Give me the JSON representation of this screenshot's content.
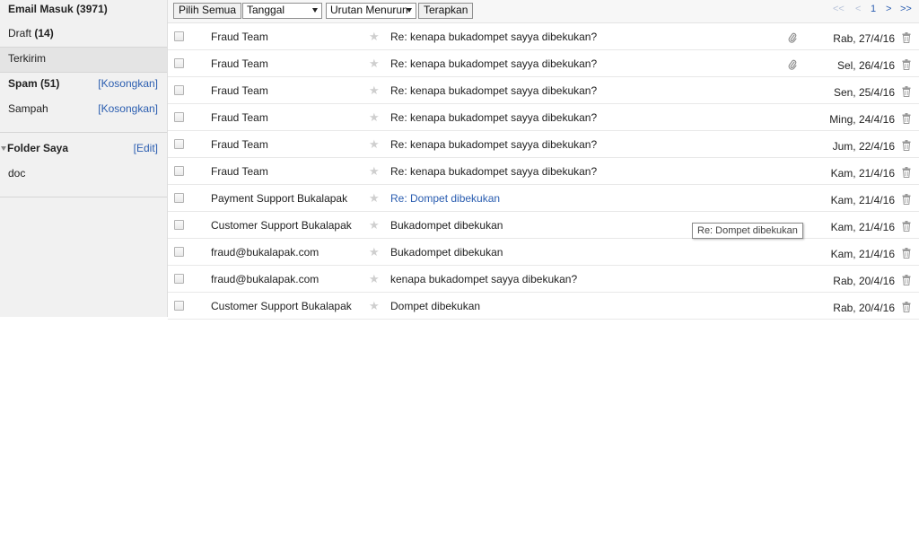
{
  "sidebar": {
    "inbox": {
      "label": "Email Masuk",
      "count": "(3971)"
    },
    "draft": {
      "label": "Draft",
      "count": "(14)"
    },
    "sent": {
      "label": "Terkirim"
    },
    "spam": {
      "label": "Spam",
      "count": "(51)",
      "action": "[Kosongkan]"
    },
    "trash": {
      "label": "Sampah",
      "action": "[Kosongkan]"
    },
    "folders": {
      "label": "Folder Saya",
      "action": "[Edit]",
      "items": [
        "doc"
      ]
    }
  },
  "toolbar": {
    "select_all": "Pilih Semua",
    "sort_field": "Tanggal",
    "sort_order": "Urutan Menurun",
    "apply": "Terapkan",
    "pager": {
      "first": "<<",
      "prev": "<",
      "current": "1",
      "next": ">",
      "last": ">>"
    }
  },
  "emails": [
    {
      "sender": "Fraud Team",
      "subject": "Re: kenapa bukadompet sayya dibekukan?",
      "date": "Rab, 27/4/16",
      "attachment": true,
      "link": false
    },
    {
      "sender": "Fraud Team",
      "subject": "Re: kenapa bukadompet sayya dibekukan?",
      "date": "Sel, 26/4/16",
      "attachment": true,
      "link": false
    },
    {
      "sender": "Fraud Team",
      "subject": "Re: kenapa bukadompet sayya dibekukan?",
      "date": "Sen, 25/4/16",
      "attachment": false,
      "link": false
    },
    {
      "sender": "Fraud Team",
      "subject": "Re: kenapa bukadompet sayya dibekukan?",
      "date": "Ming, 24/4/16",
      "attachment": false,
      "link": false
    },
    {
      "sender": "Fraud Team",
      "subject": "Re: kenapa bukadompet sayya dibekukan?",
      "date": "Jum, 22/4/16",
      "attachment": false,
      "link": false
    },
    {
      "sender": "Fraud Team",
      "subject": "Re: kenapa bukadompet sayya dibekukan?",
      "date": "Kam, 21/4/16",
      "attachment": false,
      "link": false
    },
    {
      "sender": "Payment Support Bukalapak",
      "subject": "Re: Dompet dibekukan",
      "date": "Kam, 21/4/16",
      "attachment": false,
      "link": true
    },
    {
      "sender": "Customer Support Bukalapak",
      "subject": "Bukadompet dibekukan",
      "date": "Kam, 21/4/16",
      "attachment": false,
      "link": false
    },
    {
      "sender": "fraud@bukalapak.com",
      "subject": "Bukadompet dibekukan",
      "date": "Kam, 21/4/16",
      "attachment": false,
      "link": false
    },
    {
      "sender": "fraud@bukalapak.com",
      "subject": "kenapa bukadompet sayya dibekukan?",
      "date": "Rab, 20/4/16",
      "attachment": false,
      "link": false
    },
    {
      "sender": "Customer Support Bukalapak",
      "subject": "Dompet dibekukan",
      "date": "Rab, 20/4/16",
      "attachment": false,
      "link": false
    }
  ],
  "tooltip": "Re: Dompet dibekukan",
  "icons": {
    "star": "star-icon",
    "attachment": "paperclip-icon",
    "delete": "trash-icon"
  },
  "colors": {
    "link": "#2a5db0",
    "sidebar_bg": "#f1f1f1",
    "star": "#cfcfcf"
  }
}
